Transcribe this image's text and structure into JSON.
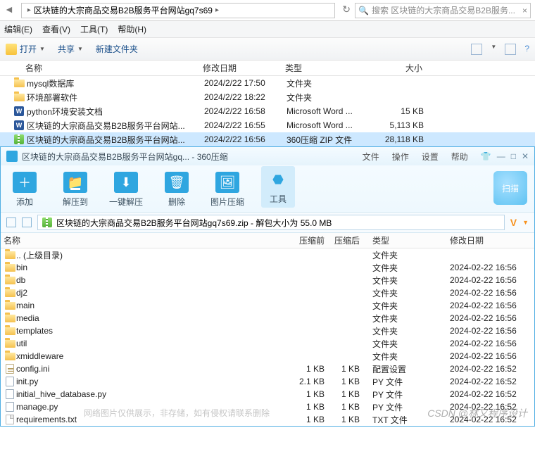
{
  "explorer": {
    "path_segment": "区块链的大宗商品交易B2B服务平台网站gq7s69",
    "search_placeholder": "搜索 区块链的大宗商品交易B2B服务...",
    "menu": {
      "edit": "编辑(E)",
      "view": "查看(V)",
      "tools": "工具(T)",
      "help": "帮助(H)"
    },
    "toolbar": {
      "open": "打开",
      "share": "共享",
      "newfolder": "新建文件夹"
    },
    "headers": {
      "name": "名称",
      "modified": "修改日期",
      "type": "类型",
      "size": "大小"
    },
    "rows": [
      {
        "icon": "folder",
        "name": "mysql数据库",
        "mod": "2024/2/22 17:50",
        "type": "文件夹",
        "size": ""
      },
      {
        "icon": "folder",
        "name": "环境部署软件",
        "mod": "2024/2/22 18:22",
        "type": "文件夹",
        "size": ""
      },
      {
        "icon": "word",
        "name": "python环境安装文档",
        "mod": "2024/2/22 16:58",
        "type": "Microsoft Word ...",
        "size": "15 KB"
      },
      {
        "icon": "word",
        "name": "区块链的大宗商品交易B2B服务平台网站...",
        "mod": "2024/2/22 16:55",
        "type": "Microsoft Word ...",
        "size": "5,113 KB"
      },
      {
        "icon": "zip",
        "name": "区块链的大宗商品交易B2B服务平台网站...",
        "mod": "2024/2/22 16:56",
        "type": "360压缩 ZIP 文件",
        "size": "28,118 KB",
        "selected": true
      }
    ]
  },
  "zip": {
    "title": "区块链的大宗商品交易B2B服务平台网站gq... - 360压缩",
    "menu": {
      "file": "文件",
      "operate": "操作",
      "setting": "设置",
      "help": "帮助"
    },
    "toolbar": {
      "add": "添加",
      "extract": "解压到",
      "oneclick": "一键解压",
      "del": "删除",
      "pic": "图片压缩",
      "tool": "工具",
      "scan": "扫描"
    },
    "path": "区块链的大宗商品交易B2B服务平台网站gq7s69.zip - 解包大小为 55.0 MB",
    "headers": {
      "name": "名称",
      "pre": "压缩前",
      "post": "压缩后",
      "type": "类型",
      "mod": "修改日期"
    },
    "rows": [
      {
        "icon": "folder",
        "name": ".. (上级目录)",
        "pre": "",
        "post": "",
        "type": "文件夹",
        "mod": ""
      },
      {
        "icon": "folder",
        "name": "bin",
        "pre": "",
        "post": "",
        "type": "文件夹",
        "mod": "2024-02-22 16:56"
      },
      {
        "icon": "folder",
        "name": "db",
        "pre": "",
        "post": "",
        "type": "文件夹",
        "mod": "2024-02-22 16:56"
      },
      {
        "icon": "folder",
        "name": "dj2",
        "pre": "",
        "post": "",
        "type": "文件夹",
        "mod": "2024-02-22 16:56"
      },
      {
        "icon": "folder",
        "name": "main",
        "pre": "",
        "post": "",
        "type": "文件夹",
        "mod": "2024-02-22 16:56"
      },
      {
        "icon": "folder",
        "name": "media",
        "pre": "",
        "post": "",
        "type": "文件夹",
        "mod": "2024-02-22 16:56"
      },
      {
        "icon": "folder",
        "name": "templates",
        "pre": "",
        "post": "",
        "type": "文件夹",
        "mod": "2024-02-22 16:56"
      },
      {
        "icon": "folder",
        "name": "util",
        "pre": "",
        "post": "",
        "type": "文件夹",
        "mod": "2024-02-22 16:56"
      },
      {
        "icon": "folder",
        "name": "xmiddleware",
        "pre": "",
        "post": "",
        "type": "文件夹",
        "mod": "2024-02-22 16:56"
      },
      {
        "icon": "ini",
        "name": "config.ini",
        "pre": "1 KB",
        "post": "1 KB",
        "type": "配置设置",
        "mod": "2024-02-22 16:52"
      },
      {
        "icon": "py",
        "name": "init.py",
        "pre": "2.1 KB",
        "post": "1 KB",
        "type": "PY 文件",
        "mod": "2024-02-22 16:52"
      },
      {
        "icon": "py",
        "name": "initial_hive_database.py",
        "pre": "1 KB",
        "post": "1 KB",
        "type": "PY 文件",
        "mod": "2024-02-22 16:52"
      },
      {
        "icon": "py",
        "name": "manage.py",
        "pre": "1 KB",
        "post": "1 KB",
        "type": "PY 文件",
        "mod": "2024-02-22 16:52"
      },
      {
        "icon": "file",
        "name": "requirements.txt",
        "pre": "1 KB",
        "post": "1 KB",
        "type": "TXT 文件",
        "mod": "2024-02-22 16:52"
      }
    ]
  },
  "watermarks": {
    "csdn": "CSDN @林又程序设计",
    "note": "网络图片仅供展示，非存储，如有侵权请联系删除"
  }
}
